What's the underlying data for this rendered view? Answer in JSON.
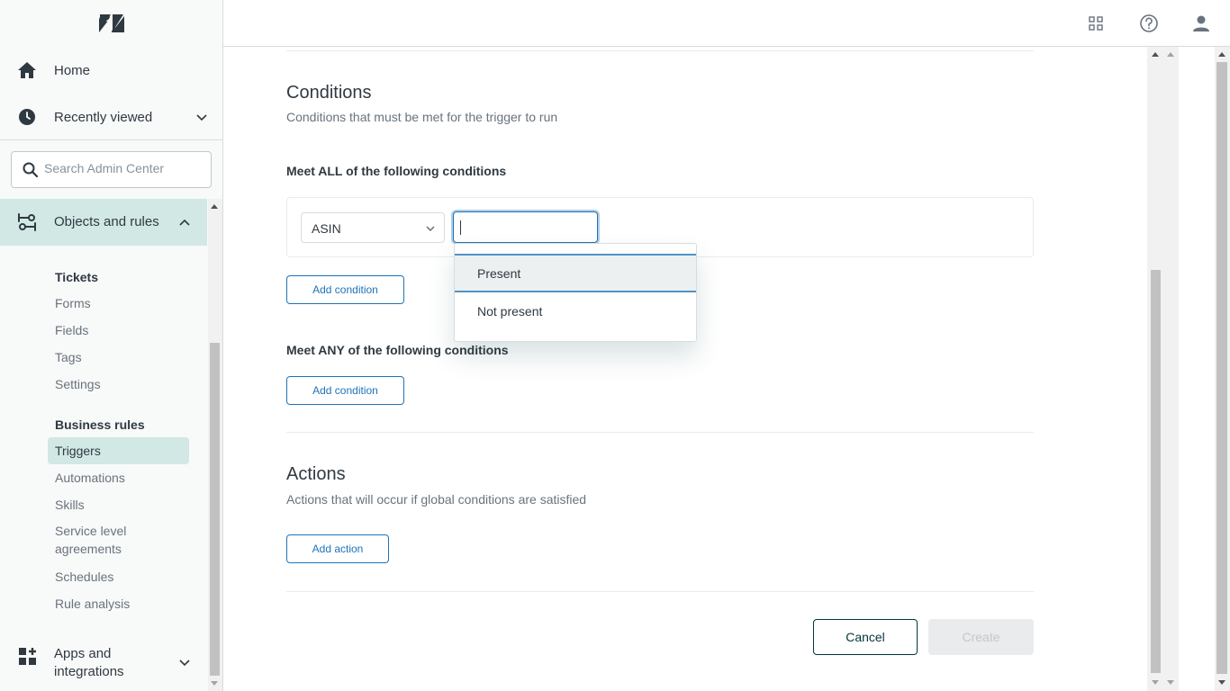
{
  "sidebar": {
    "logo_icon": "zendesk-logo-icon",
    "home_label": "Home",
    "recently_viewed_label": "Recently viewed",
    "search_placeholder": "Search Admin Center",
    "objects_rules_label": "Objects and rules",
    "tickets_heading": "Tickets",
    "tickets_items": [
      "Forms",
      "Fields",
      "Tags",
      "Settings"
    ],
    "business_rules_heading": "Business rules",
    "business_rules_items": [
      "Triggers",
      "Automations",
      "Skills",
      "Service level agreements",
      "Schedules",
      "Rule analysis"
    ],
    "active_item": "Triggers",
    "apps_label_line1": "Apps and",
    "apps_label_line2": "integrations"
  },
  "header": {
    "icons": [
      "apps-grid-icon",
      "help-icon",
      "user-profile-icon"
    ]
  },
  "conditions": {
    "title": "Conditions",
    "description": "Conditions that must be met for the trigger to run",
    "all_heading": "Meet ALL of the following conditions",
    "field_select_value": "ASIN",
    "operator_input_value": "",
    "dropdown_options": [
      "Present",
      "Not present"
    ],
    "highlighted_option": "Present",
    "add_condition_all": "Add condition",
    "any_heading": "Meet ANY of the following conditions",
    "add_condition_any": "Add condition"
  },
  "actions": {
    "title": "Actions",
    "description": "Actions that will occur if global conditions are satisfied",
    "add_action": "Add action"
  },
  "footer": {
    "cancel_label": "Cancel",
    "create_label": "Create"
  },
  "colors": {
    "accent": "#1f73b7",
    "active_nav_bg": "#d1e8e4",
    "brand_dark": "#03363d"
  }
}
